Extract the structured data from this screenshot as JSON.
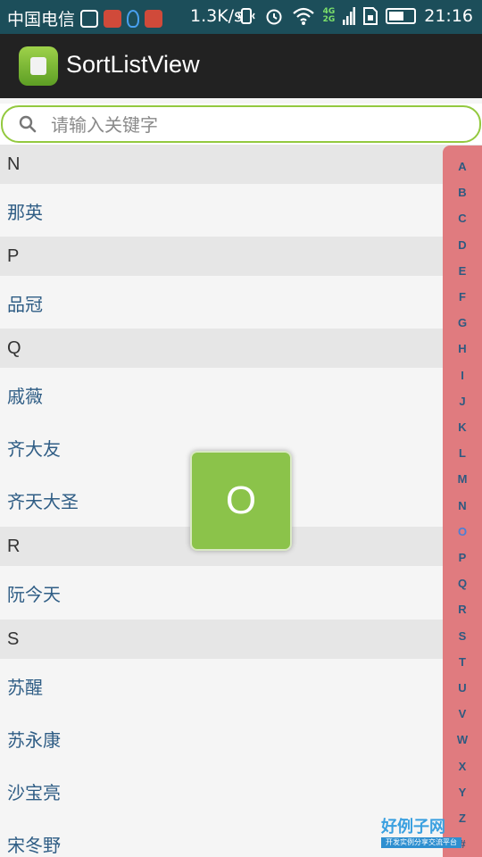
{
  "status_bar": {
    "carrier": "中国电信",
    "speed": "1.3K/s",
    "network_label_top": "4G",
    "network_label_bottom": "2G",
    "time": "21:16"
  },
  "app_bar": {
    "title": "SortListView",
    "logo_icon": "android-app-icon"
  },
  "search": {
    "placeholder": "请输入关键字",
    "value": "",
    "icon": "search-icon"
  },
  "list": {
    "rows": [
      {
        "type": "header",
        "text": "N"
      },
      {
        "type": "item",
        "text": "那英"
      },
      {
        "type": "header",
        "text": "P"
      },
      {
        "type": "item",
        "text": "品冠"
      },
      {
        "type": "header",
        "text": "Q"
      },
      {
        "type": "item",
        "text": "戚薇"
      },
      {
        "type": "item",
        "text": "齐大友"
      },
      {
        "type": "item",
        "text": "齐天大圣"
      },
      {
        "type": "header",
        "text": "R"
      },
      {
        "type": "item",
        "text": "阮今天"
      },
      {
        "type": "header",
        "text": "S"
      },
      {
        "type": "item",
        "text": "苏醒"
      },
      {
        "type": "item",
        "text": "苏永康"
      },
      {
        "type": "item",
        "text": "沙宝亮"
      },
      {
        "type": "item",
        "text": "宋冬野"
      }
    ]
  },
  "sidebar": {
    "letters": [
      "A",
      "B",
      "C",
      "D",
      "E",
      "F",
      "G",
      "H",
      "I",
      "J",
      "K",
      "L",
      "M",
      "N",
      "O",
      "P",
      "Q",
      "R",
      "S",
      "T",
      "U",
      "V",
      "W",
      "X",
      "Y",
      "Z",
      "#"
    ],
    "selected": "O",
    "background_color": "#e07b7f"
  },
  "overlay": {
    "letter": "O",
    "color": "#8bc34a"
  },
  "watermark": {
    "title": "好例子网",
    "subtitle": "开发实例分享交流平台"
  },
  "colors": {
    "status_bar": "#1c4e5a",
    "app_bar": "#222222",
    "accent_green": "#93c93f",
    "item_text": "#2f5d85",
    "section_header_bg": "#e6e6e6"
  }
}
